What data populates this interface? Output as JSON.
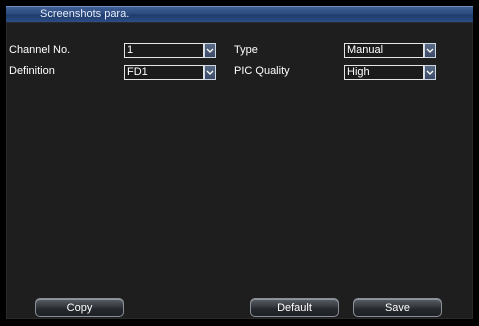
{
  "window": {
    "title": "Screenshots para."
  },
  "form": {
    "channel_label": "Channel No.",
    "channel_value": "1",
    "type_label": "Type",
    "type_value": "Manual",
    "definition_label": "Definition",
    "definition_value": "FD1",
    "quality_label": "PIC Quality",
    "quality_value": "High"
  },
  "buttons": {
    "copy": "Copy",
    "default": "Default",
    "save": "Save"
  },
  "icons": {
    "dropdown": "chevron-down-icon"
  }
}
